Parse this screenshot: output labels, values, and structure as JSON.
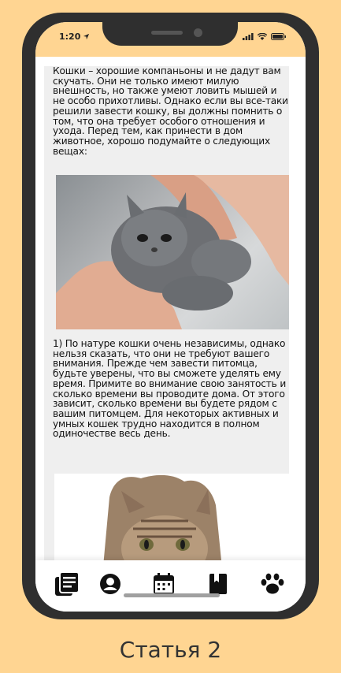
{
  "status": {
    "time": "1:20"
  },
  "article": {
    "paragraph1": "Кошки – хорошие компаньоны и не дадут вам скучать. Они не только имеют милую внешность, но также умеют ловить мышей и не особо прихотливы. Однако если вы все-таки решили завести кошку, вы должны помнить о том, что она требует особого отношения и ухода. Перед тем, как принести в дом животное, хорошо подумайте о следующих вещах:",
    "paragraph2": "1) По натуре кошки очень независимы, однако нельзя сказать, что они не требуют вашего внимания. Прежде чем завести питомца, будьте уверены, что вы сможете уделять ему время. Примите во внимание свою занятость и сколько времени вы проводите дома. От этого зависит, сколько времени вы будете рядом с вашим питомцем. Для некоторых активных и умных кошек трудно находится в полном одиночестве весь день."
  },
  "tabs": [
    {
      "icon": "articles-icon"
    },
    {
      "icon": "profile-icon"
    },
    {
      "icon": "calendar-icon"
    },
    {
      "icon": "book-icon"
    },
    {
      "icon": "paw-icon"
    }
  ],
  "caption": "Статья 2",
  "colors": {
    "background": "#FFD592",
    "phone_frame": "#2F2F2F",
    "content_bg": "#EFEFEF",
    "icon": "#111111"
  }
}
